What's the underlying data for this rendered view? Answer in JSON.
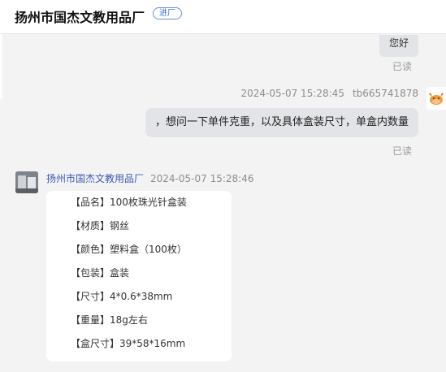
{
  "header": {
    "shop_name": "扬州市国杰文教用品厂",
    "enter_badge": "进厂"
  },
  "messages": {
    "incoming_greeting": "您好",
    "read_label_1": "已读",
    "outgoing_timestamp": "2024-05-07 15:28:45",
    "outgoing_sender": "tb665741878",
    "outgoing_text": "，想问一下单件克重，以及具体盒装尺寸，单盒内数量",
    "read_label_2": "已读",
    "reply_sender": "扬州市国杰文教用品厂",
    "reply_timestamp": "2024-05-07 15:28:46"
  },
  "product_specs": [
    "【品名】100枚珠光针盒装",
    "【材质】钢丝",
    "【颜色】塑料盒（100枚）",
    "【包装】盒装",
    "【尺寸】4*0.6*38mm",
    "【重量】18g左右",
    "【盒尺寸】39*58*16mm"
  ],
  "colors": {
    "background": "#f3f3f4",
    "bubble": "#e3e4e7",
    "sender_name": "#3f57b8",
    "badge": "#3d6fd1"
  },
  "icons": {
    "buyer_avatar": "cartoon-cow-avatar-icon",
    "seller_avatar": "shop-photo-avatar"
  }
}
